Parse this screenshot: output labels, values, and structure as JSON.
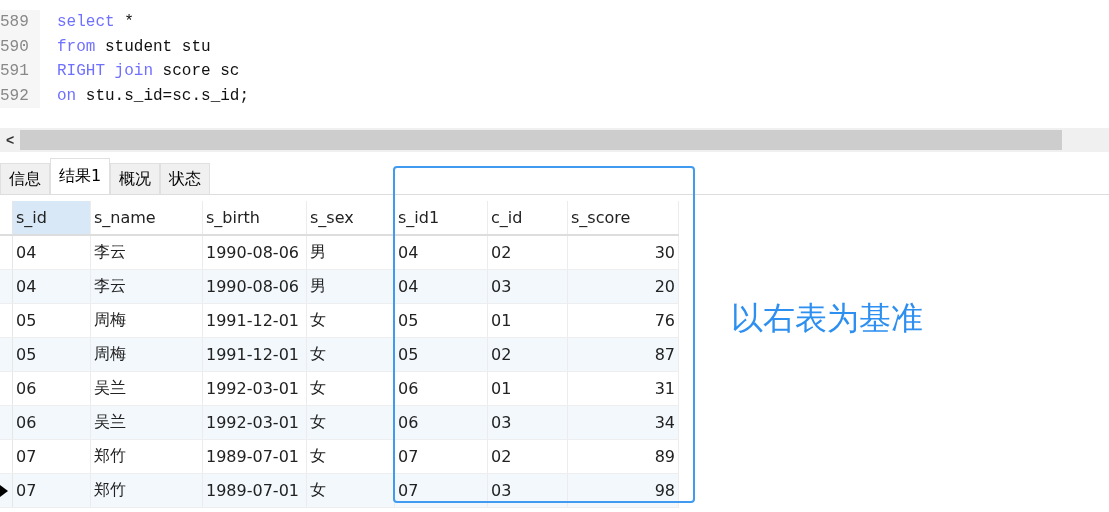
{
  "editor": {
    "lines": [
      {
        "number": "589",
        "tokens": [
          {
            "text": "select",
            "kind": "keyword"
          },
          {
            "text": " *",
            "kind": "plain"
          }
        ]
      },
      {
        "number": "590",
        "tokens": [
          {
            "text": "from",
            "kind": "keyword"
          },
          {
            "text": " student stu",
            "kind": "plain"
          }
        ]
      },
      {
        "number": "591",
        "tokens": [
          {
            "text": "RIGHT join",
            "kind": "keyword"
          },
          {
            "text": " score sc",
            "kind": "plain"
          }
        ]
      },
      {
        "number": "592",
        "tokens": [
          {
            "text": "on",
            "kind": "keyword"
          },
          {
            "text": " stu.s_id=sc.s_id;",
            "kind": "plain"
          }
        ]
      }
    ],
    "scroll_left": "<"
  },
  "tabs": [
    {
      "label": "信息",
      "selected": false
    },
    {
      "label": "结果1",
      "selected": true
    },
    {
      "label": "概况",
      "selected": false
    },
    {
      "label": "状态",
      "selected": false
    }
  ],
  "table": {
    "columns": [
      {
        "label": "s_id",
        "selected": true
      },
      {
        "label": "s_name",
        "selected": false
      },
      {
        "label": "s_birth",
        "selected": false
      },
      {
        "label": "s_sex",
        "selected": false
      },
      {
        "label": "s_id1",
        "selected": false
      },
      {
        "label": "c_id",
        "selected": false
      },
      {
        "label": "s_score",
        "selected": false
      }
    ],
    "rows": [
      {
        "current": false,
        "cells": [
          "04",
          "李云",
          "1990-08-06",
          "男",
          "04",
          "02",
          "30"
        ]
      },
      {
        "current": false,
        "cells": [
          "04",
          "李云",
          "1990-08-06",
          "男",
          "04",
          "03",
          "20"
        ]
      },
      {
        "current": false,
        "cells": [
          "05",
          "周梅",
          "1991-12-01",
          "女",
          "05",
          "01",
          "76"
        ]
      },
      {
        "current": false,
        "cells": [
          "05",
          "周梅",
          "1991-12-01",
          "女",
          "05",
          "02",
          "87"
        ]
      },
      {
        "current": false,
        "cells": [
          "06",
          "吴兰",
          "1992-03-01",
          "女",
          "06",
          "01",
          "31"
        ]
      },
      {
        "current": false,
        "cells": [
          "06",
          "吴兰",
          "1992-03-01",
          "女",
          "06",
          "03",
          "34"
        ]
      },
      {
        "current": false,
        "cells": [
          "07",
          "郑竹",
          "1989-07-01",
          "女",
          "07",
          "02",
          "89"
        ]
      },
      {
        "current": true,
        "cells": [
          "07",
          "郑竹",
          "1989-07-01",
          "女",
          "07",
          "03",
          "98"
        ]
      }
    ]
  },
  "annotation": "以右表为基准"
}
